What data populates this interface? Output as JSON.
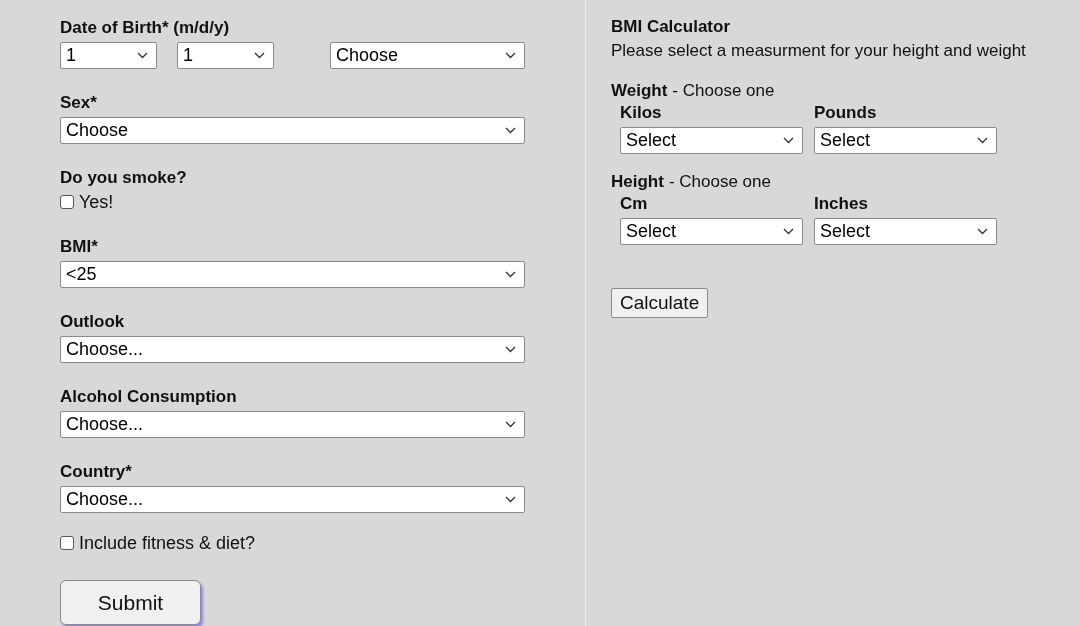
{
  "registration_form": {
    "date_of_birth": {
      "label": "Date of Birth* (m/d/y)",
      "month": "1",
      "day": "1",
      "year": "Choose"
    },
    "fields": [
      {
        "kind": "select",
        "label": "Sex*",
        "value": "Choose"
      },
      {
        "kind": "checkbox",
        "label": "Do you smoke?",
        "option": "Yes!",
        "checked": false
      },
      {
        "kind": "select",
        "label": "BMI*",
        "value": "<25"
      },
      {
        "kind": "select",
        "label": "Outlook",
        "value": "Choose..."
      },
      {
        "kind": "select",
        "label": "Alcohol Consumption",
        "value": "Choose..."
      },
      {
        "kind": "select",
        "label": "Country*",
        "value": "Choose..."
      },
      {
        "kind": "checkbox",
        "option": "Include fitness & diet?",
        "checked": false
      }
    ],
    "submit_button": "Submit"
  },
  "bmi_calculator": {
    "title": "BMI Calculator",
    "subtitle": "Please select a measurment for your height and weight",
    "groups": [
      {
        "title": "Weight",
        "hint": "- Choose one",
        "units": [
          {
            "label": "Kilos",
            "value": "Select"
          },
          {
            "label": "Pounds",
            "value": "Select"
          }
        ]
      },
      {
        "title": "Height",
        "hint": "- Choose one",
        "units": [
          {
            "label": "Cm",
            "value": "Select"
          },
          {
            "label": "Inches",
            "value": "Select"
          }
        ]
      }
    ],
    "calculate_button": "Calculate"
  }
}
